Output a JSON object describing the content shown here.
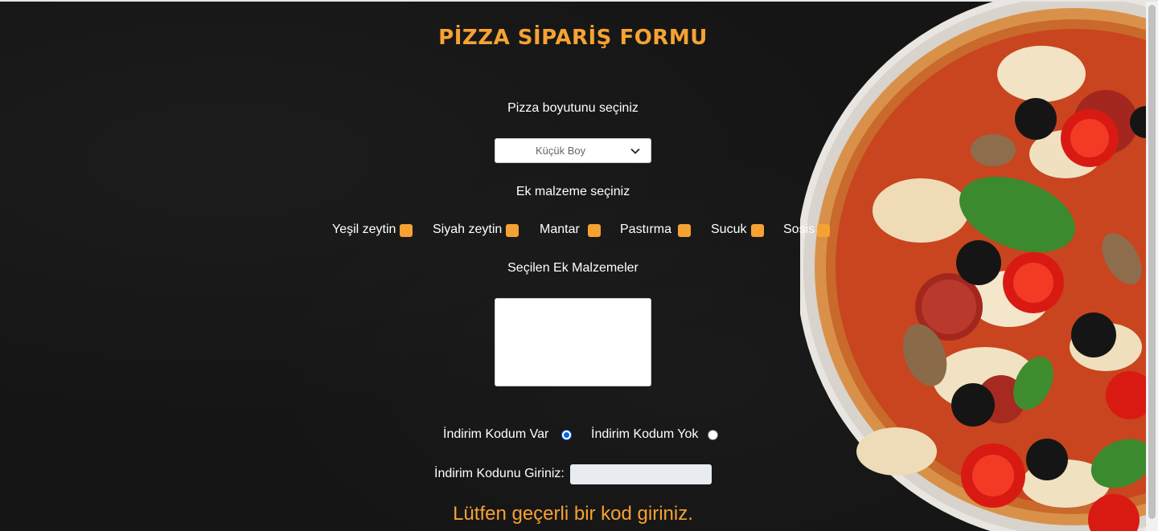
{
  "form": {
    "title": "PİZZA SİPARİŞ FORMU",
    "size_label": "Pizza boyutunu seçiniz",
    "size_select": {
      "selected": "Küçük Boy"
    },
    "extras_label": "Ek malzeme seçiniz",
    "toppings": [
      {
        "label": "Yeşil zeytin",
        "checked": false
      },
      {
        "label": "Siyah zeytin",
        "checked": false
      },
      {
        "label": "Mantar",
        "checked": false
      },
      {
        "label": "Pastırma",
        "checked": false
      },
      {
        "label": "Sucuk",
        "checked": false
      },
      {
        "label": "Sosis",
        "checked": false
      }
    ],
    "selected_extras_label": "Seçilen Ek Malzemeler",
    "selected_extras_value": "",
    "discount_options": [
      {
        "label": "İndirim Kodum Var",
        "checked": true
      },
      {
        "label": "İndirim Kodum Yok",
        "checked": false
      }
    ],
    "code_label": "İndirim Kodunu Giriniz:",
    "code_value": "",
    "error_message": "Lütfen geçerli bir kod giriniz."
  },
  "colors": {
    "accent": "#f6a233",
    "background": "#151515",
    "radio_checked": "#0b64d8"
  },
  "icons": {
    "select_chevron": "chevron-down-icon"
  }
}
